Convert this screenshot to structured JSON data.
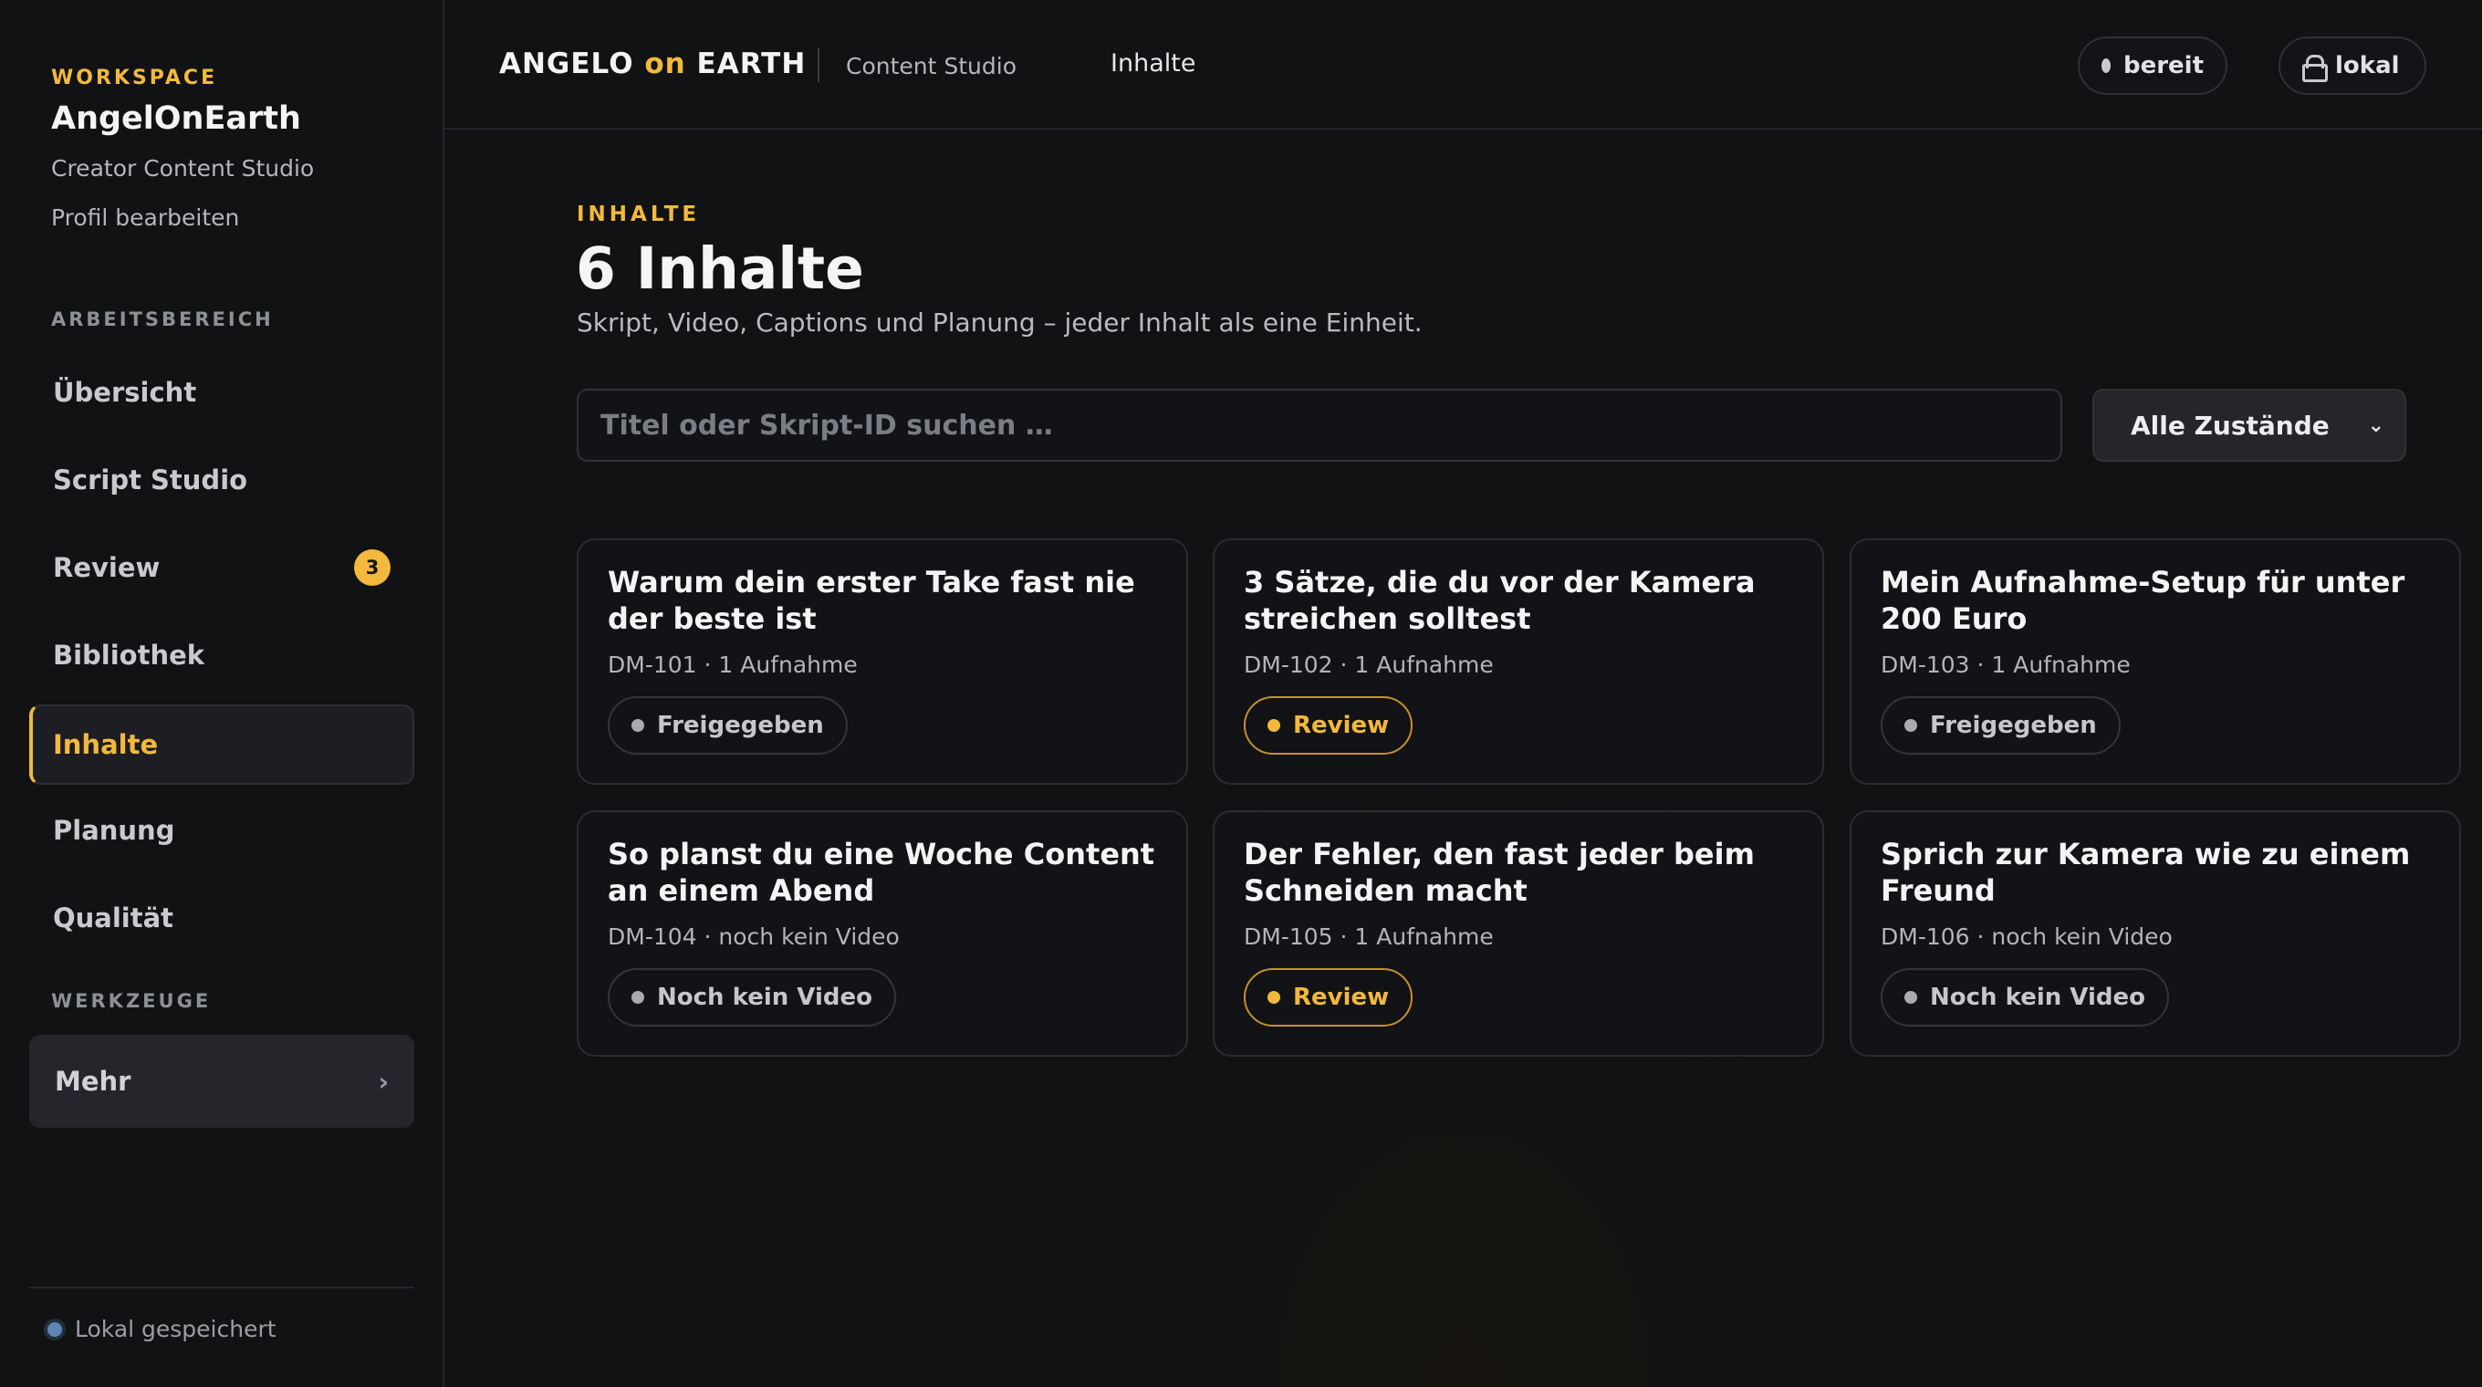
{
  "sidebar": {
    "workspace_label": "WORKSPACE",
    "workspace_name": "AngelOnEarth",
    "workspace_sub": "Creator Content Studio",
    "edit_profile": "Profil bearbeiten",
    "section_work": "ARBEITSBEREICH",
    "items": [
      {
        "label": "Übersicht"
      },
      {
        "label": "Script Studio"
      },
      {
        "label": "Review",
        "badge": "3"
      },
      {
        "label": "Bibliothek"
      },
      {
        "label": "Inhalte"
      },
      {
        "label": "Planung"
      },
      {
        "label": "Qualität"
      }
    ],
    "section_tools": "WERKZEUGE",
    "more_label": "Mehr",
    "saved_label": "Lokal gespeichert"
  },
  "header": {
    "brand_a": "ANGELO",
    "brand_on": "on",
    "brand_b": "EARTH",
    "studio": "Content Studio",
    "crumb": "Inhalte",
    "status_ready": "bereit",
    "status_local": "lokal"
  },
  "main": {
    "kicker": "INHALTE",
    "title": "6 Inhalte",
    "subtitle": "Skript, Video, Captions und Planung – jeder Inhalt als eine Einheit.",
    "search_placeholder": "Titel oder Skript-ID suchen …",
    "filter_label": "Alle Zustände"
  },
  "cards": [
    {
      "title": "Warum dein erster Take fast nie der beste ist",
      "meta": "DM-101 · 1 Aufnahme",
      "status": "Freigegeben"
    },
    {
      "title": "3 Sätze, die du vor der Kamera streichen solltest",
      "meta": "DM-102 · 1 Aufnahme",
      "status": "Review"
    },
    {
      "title": "Mein Aufnahme-Setup für unter 200 Euro",
      "meta": "DM-103 · 1 Aufnahme",
      "status": "Freigegeben"
    },
    {
      "title": "So planst du eine Woche Content an einem Abend",
      "meta": "DM-104 · noch kein Video",
      "status": "Noch kein Video"
    },
    {
      "title": "Der Fehler, den fast jeder beim Schneiden macht",
      "meta": "DM-105 · 1 Aufnahme",
      "status": "Review"
    },
    {
      "title": "Sprich zur Kamera wie zu einem Freund",
      "meta": "DM-106 · noch kein Video",
      "status": "Noch kein Video"
    }
  ],
  "colors": {
    "accent": "#f3b93c",
    "background": "#111214",
    "card": "#121316"
  }
}
